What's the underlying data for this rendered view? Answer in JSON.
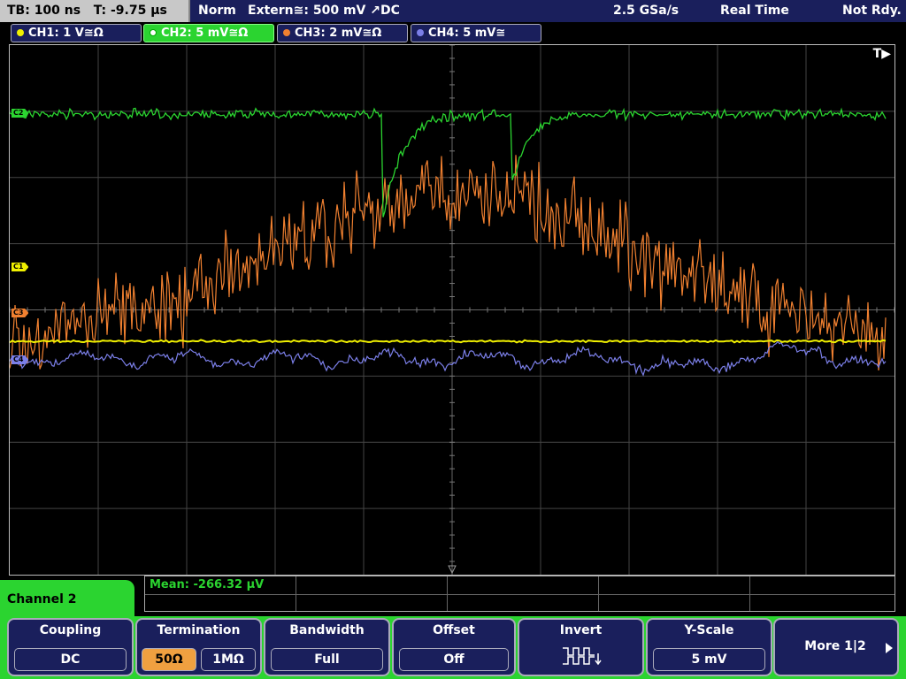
{
  "topbar": {
    "timebase": "TB: 100 ns",
    "trigger_time": "T: -9.75 µs",
    "mode": "Norm",
    "trigger_source": "Extern≅: 500 mV ↗DC",
    "sample_rate": "2.5 GSa/s",
    "acq_mode": "Real Time",
    "status": "Not Rdy."
  },
  "channels": [
    {
      "label": "CH1: 1 V≅Ω",
      "color": "#f0f000"
    },
    {
      "label": "CH2: 5 mV≅Ω",
      "color": "#2bd430"
    },
    {
      "label": "CH3: 2 mV≅Ω",
      "color": "#f08030"
    },
    {
      "label": "CH4: 5 mV≅",
      "color": "#7b7fe8"
    }
  ],
  "plot": {
    "trigger_marker": "T▶",
    "markers": {
      "c1": "C1",
      "c2": "C2",
      "c3": "C3",
      "c4": "C4"
    }
  },
  "measurement": {
    "text": "Mean: -266.32 µV"
  },
  "menu": {
    "title": "Channel 2",
    "softkeys": {
      "coupling": {
        "title": "Coupling",
        "value": "DC"
      },
      "termination": {
        "title": "Termination",
        "opt1": "50Ω",
        "opt2": "1MΩ"
      },
      "bandwidth": {
        "title": "Bandwidth",
        "value": "Full"
      },
      "offset": {
        "title": "Offset",
        "value": "Off"
      },
      "invert": {
        "title": "Invert",
        "icon": "invert-waveform-icon"
      },
      "yscale": {
        "title": "Y-Scale",
        "value": "5 mV"
      },
      "more": {
        "label": "More 1|2"
      }
    }
  },
  "colors": {
    "ch1": "#f0f000",
    "ch2": "#2bd430",
    "ch3": "#f08030",
    "ch4": "#7b7fe8",
    "panel": "#1a1f5c",
    "grid": "#555555"
  }
}
